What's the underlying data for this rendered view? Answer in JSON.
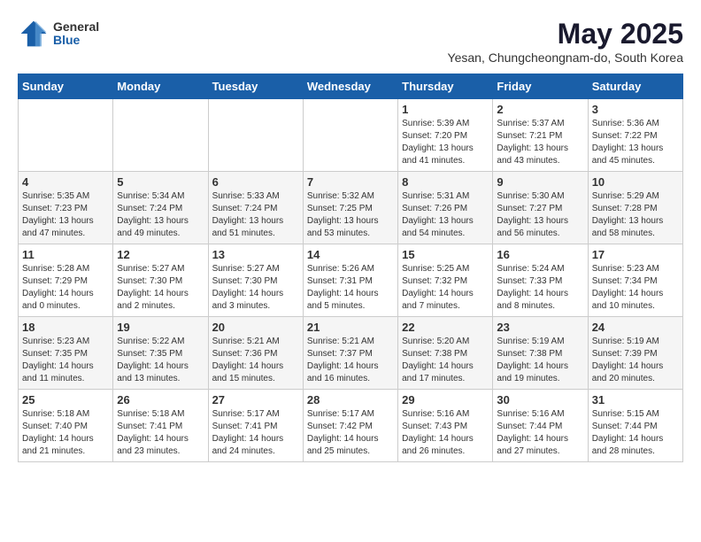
{
  "logo": {
    "general": "General",
    "blue": "Blue"
  },
  "title": "May 2025",
  "subtitle": "Yesan, Chungcheongnam-do, South Korea",
  "days_header": [
    "Sunday",
    "Monday",
    "Tuesday",
    "Wednesday",
    "Thursday",
    "Friday",
    "Saturday"
  ],
  "weeks": [
    [
      {
        "num": "",
        "info": ""
      },
      {
        "num": "",
        "info": ""
      },
      {
        "num": "",
        "info": ""
      },
      {
        "num": "",
        "info": ""
      },
      {
        "num": "1",
        "info": "Sunrise: 5:39 AM\nSunset: 7:20 PM\nDaylight: 13 hours\nand 41 minutes."
      },
      {
        "num": "2",
        "info": "Sunrise: 5:37 AM\nSunset: 7:21 PM\nDaylight: 13 hours\nand 43 minutes."
      },
      {
        "num": "3",
        "info": "Sunrise: 5:36 AM\nSunset: 7:22 PM\nDaylight: 13 hours\nand 45 minutes."
      }
    ],
    [
      {
        "num": "4",
        "info": "Sunrise: 5:35 AM\nSunset: 7:23 PM\nDaylight: 13 hours\nand 47 minutes."
      },
      {
        "num": "5",
        "info": "Sunrise: 5:34 AM\nSunset: 7:24 PM\nDaylight: 13 hours\nand 49 minutes."
      },
      {
        "num": "6",
        "info": "Sunrise: 5:33 AM\nSunset: 7:24 PM\nDaylight: 13 hours\nand 51 minutes."
      },
      {
        "num": "7",
        "info": "Sunrise: 5:32 AM\nSunset: 7:25 PM\nDaylight: 13 hours\nand 53 minutes."
      },
      {
        "num": "8",
        "info": "Sunrise: 5:31 AM\nSunset: 7:26 PM\nDaylight: 13 hours\nand 54 minutes."
      },
      {
        "num": "9",
        "info": "Sunrise: 5:30 AM\nSunset: 7:27 PM\nDaylight: 13 hours\nand 56 minutes."
      },
      {
        "num": "10",
        "info": "Sunrise: 5:29 AM\nSunset: 7:28 PM\nDaylight: 13 hours\nand 58 minutes."
      }
    ],
    [
      {
        "num": "11",
        "info": "Sunrise: 5:28 AM\nSunset: 7:29 PM\nDaylight: 14 hours\nand 0 minutes."
      },
      {
        "num": "12",
        "info": "Sunrise: 5:27 AM\nSunset: 7:30 PM\nDaylight: 14 hours\nand 2 minutes."
      },
      {
        "num": "13",
        "info": "Sunrise: 5:27 AM\nSunset: 7:30 PM\nDaylight: 14 hours\nand 3 minutes."
      },
      {
        "num": "14",
        "info": "Sunrise: 5:26 AM\nSunset: 7:31 PM\nDaylight: 14 hours\nand 5 minutes."
      },
      {
        "num": "15",
        "info": "Sunrise: 5:25 AM\nSunset: 7:32 PM\nDaylight: 14 hours\nand 7 minutes."
      },
      {
        "num": "16",
        "info": "Sunrise: 5:24 AM\nSunset: 7:33 PM\nDaylight: 14 hours\nand 8 minutes."
      },
      {
        "num": "17",
        "info": "Sunrise: 5:23 AM\nSunset: 7:34 PM\nDaylight: 14 hours\nand 10 minutes."
      }
    ],
    [
      {
        "num": "18",
        "info": "Sunrise: 5:23 AM\nSunset: 7:35 PM\nDaylight: 14 hours\nand 11 minutes."
      },
      {
        "num": "19",
        "info": "Sunrise: 5:22 AM\nSunset: 7:35 PM\nDaylight: 14 hours\nand 13 minutes."
      },
      {
        "num": "20",
        "info": "Sunrise: 5:21 AM\nSunset: 7:36 PM\nDaylight: 14 hours\nand 15 minutes."
      },
      {
        "num": "21",
        "info": "Sunrise: 5:21 AM\nSunset: 7:37 PM\nDaylight: 14 hours\nand 16 minutes."
      },
      {
        "num": "22",
        "info": "Sunrise: 5:20 AM\nSunset: 7:38 PM\nDaylight: 14 hours\nand 17 minutes."
      },
      {
        "num": "23",
        "info": "Sunrise: 5:19 AM\nSunset: 7:38 PM\nDaylight: 14 hours\nand 19 minutes."
      },
      {
        "num": "24",
        "info": "Sunrise: 5:19 AM\nSunset: 7:39 PM\nDaylight: 14 hours\nand 20 minutes."
      }
    ],
    [
      {
        "num": "25",
        "info": "Sunrise: 5:18 AM\nSunset: 7:40 PM\nDaylight: 14 hours\nand 21 minutes."
      },
      {
        "num": "26",
        "info": "Sunrise: 5:18 AM\nSunset: 7:41 PM\nDaylight: 14 hours\nand 23 minutes."
      },
      {
        "num": "27",
        "info": "Sunrise: 5:17 AM\nSunset: 7:41 PM\nDaylight: 14 hours\nand 24 minutes."
      },
      {
        "num": "28",
        "info": "Sunrise: 5:17 AM\nSunset: 7:42 PM\nDaylight: 14 hours\nand 25 minutes."
      },
      {
        "num": "29",
        "info": "Sunrise: 5:16 AM\nSunset: 7:43 PM\nDaylight: 14 hours\nand 26 minutes."
      },
      {
        "num": "30",
        "info": "Sunrise: 5:16 AM\nSunset: 7:44 PM\nDaylight: 14 hours\nand 27 minutes."
      },
      {
        "num": "31",
        "info": "Sunrise: 5:15 AM\nSunset: 7:44 PM\nDaylight: 14 hours\nand 28 minutes."
      }
    ]
  ]
}
